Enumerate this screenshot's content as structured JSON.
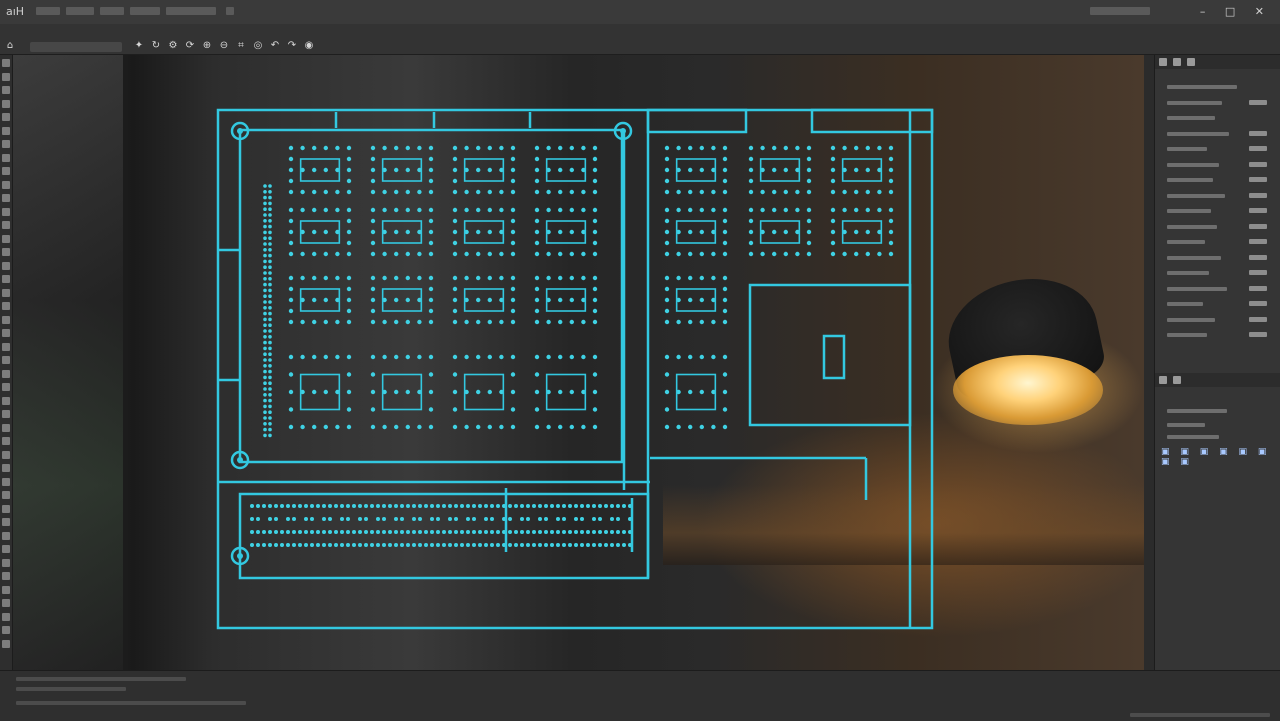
{
  "app": {
    "title": "aıH",
    "window_controls": "– □ ✕"
  },
  "options_bar": {
    "icons": [
      "move-tool-icon",
      "rotate-icon",
      "settings-icon",
      "refresh-icon",
      "zoom-in-icon",
      "zoom-out-icon",
      "crop-icon",
      "reset-icon",
      "undo-icon",
      "redo-icon",
      "visibility-icon"
    ],
    "icon_glyphs": [
      "✦",
      "↻",
      "⚙",
      "⟳",
      "⊕",
      "⊖",
      "⌗",
      "◎",
      "↶",
      "↷",
      "◉"
    ]
  },
  "layers_panel": {
    "icon_glyphs": "▣ ▣ ▣ ▣ ▣ ▣ ▣ ▣"
  },
  "colors": {
    "blueprint_line": "#33c8e0",
    "blueprint_dot": "#3fd2e4",
    "panel_bg": "#353535",
    "canvas_bg": "#2a2a2a",
    "lamp_glow": "#ffd27a"
  }
}
